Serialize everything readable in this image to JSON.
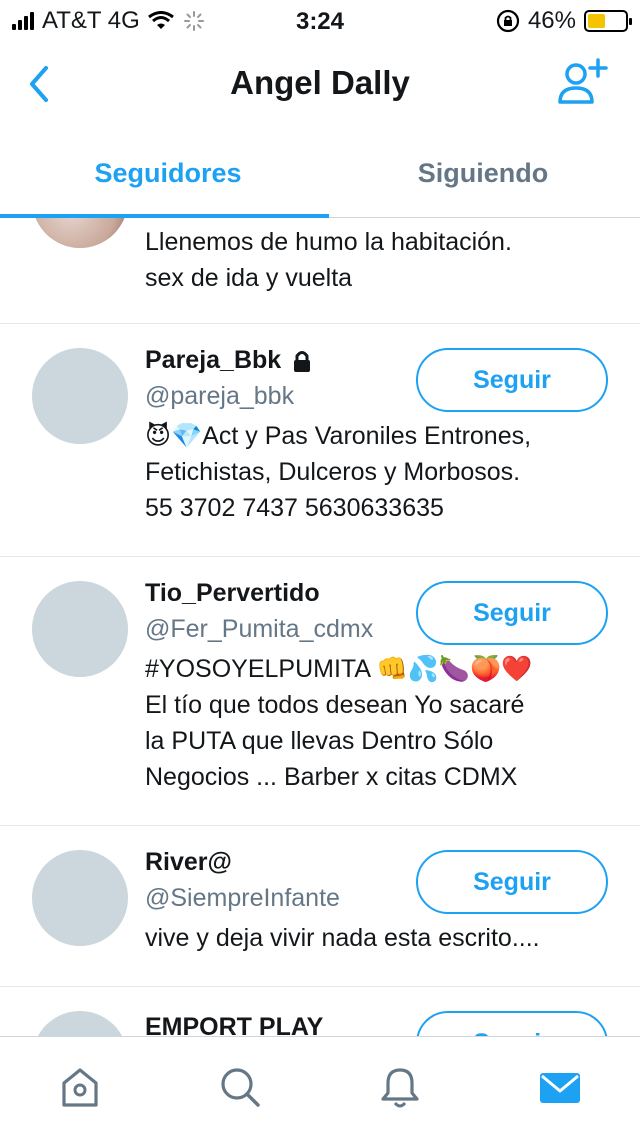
{
  "status_bar": {
    "carrier": "AT&T 4G",
    "time": "3:24",
    "battery_percent": "46%",
    "battery_level": 0.46,
    "battery_color": "#f5c400"
  },
  "header": {
    "title": "Angel Dally",
    "back_icon": "chevron-left-icon",
    "action_icon": "add-user-icon"
  },
  "tabs": [
    {
      "label": "Seguidores",
      "active": true
    },
    {
      "label": "Siguiendo",
      "active": false
    }
  ],
  "accent_color": "#1da1f2",
  "followers": [
    {
      "name": "",
      "handle": "",
      "bio_lines": [
        "Llenemos de humo la habitación.",
        "sex de ida y vuelta"
      ],
      "button": ""
    },
    {
      "name": "Pareja_Bbk",
      "protected": true,
      "handle": "@pareja_bbk",
      "bio_lines": [
        "😈💎Act y Pas Varoniles Entrones,",
        "Fetichistas, Dulceros y Morbosos.",
        "55 3702 7437 5630633635"
      ],
      "button": "Seguir"
    },
    {
      "name": "Tio_Pervertido",
      "handle": "@Fer_Pumita_cdmx",
      "bio_lines": [
        "#YOSOYELPUMITA 👊💦🍆🍑❤️",
        "El tío que todos desean Yo sacaré",
        "la PUTA que llevas Dentro Sólo",
        "Negocios ... Barber x citas CDMX"
      ],
      "button": "Seguir"
    },
    {
      "name": "River@",
      "handle": "@SiempreInfante",
      "bio_lines": [
        "vive y deja vivir nada esta escrito...."
      ],
      "button": "Seguir"
    },
    {
      "name": "EMPORT PLAY",
      "handle": "",
      "bio_lines": [],
      "button": "Seguir"
    }
  ],
  "bottom_bar": [
    "home-icon",
    "search-icon",
    "notifications-bell-icon",
    "messages-envelope-icon"
  ]
}
